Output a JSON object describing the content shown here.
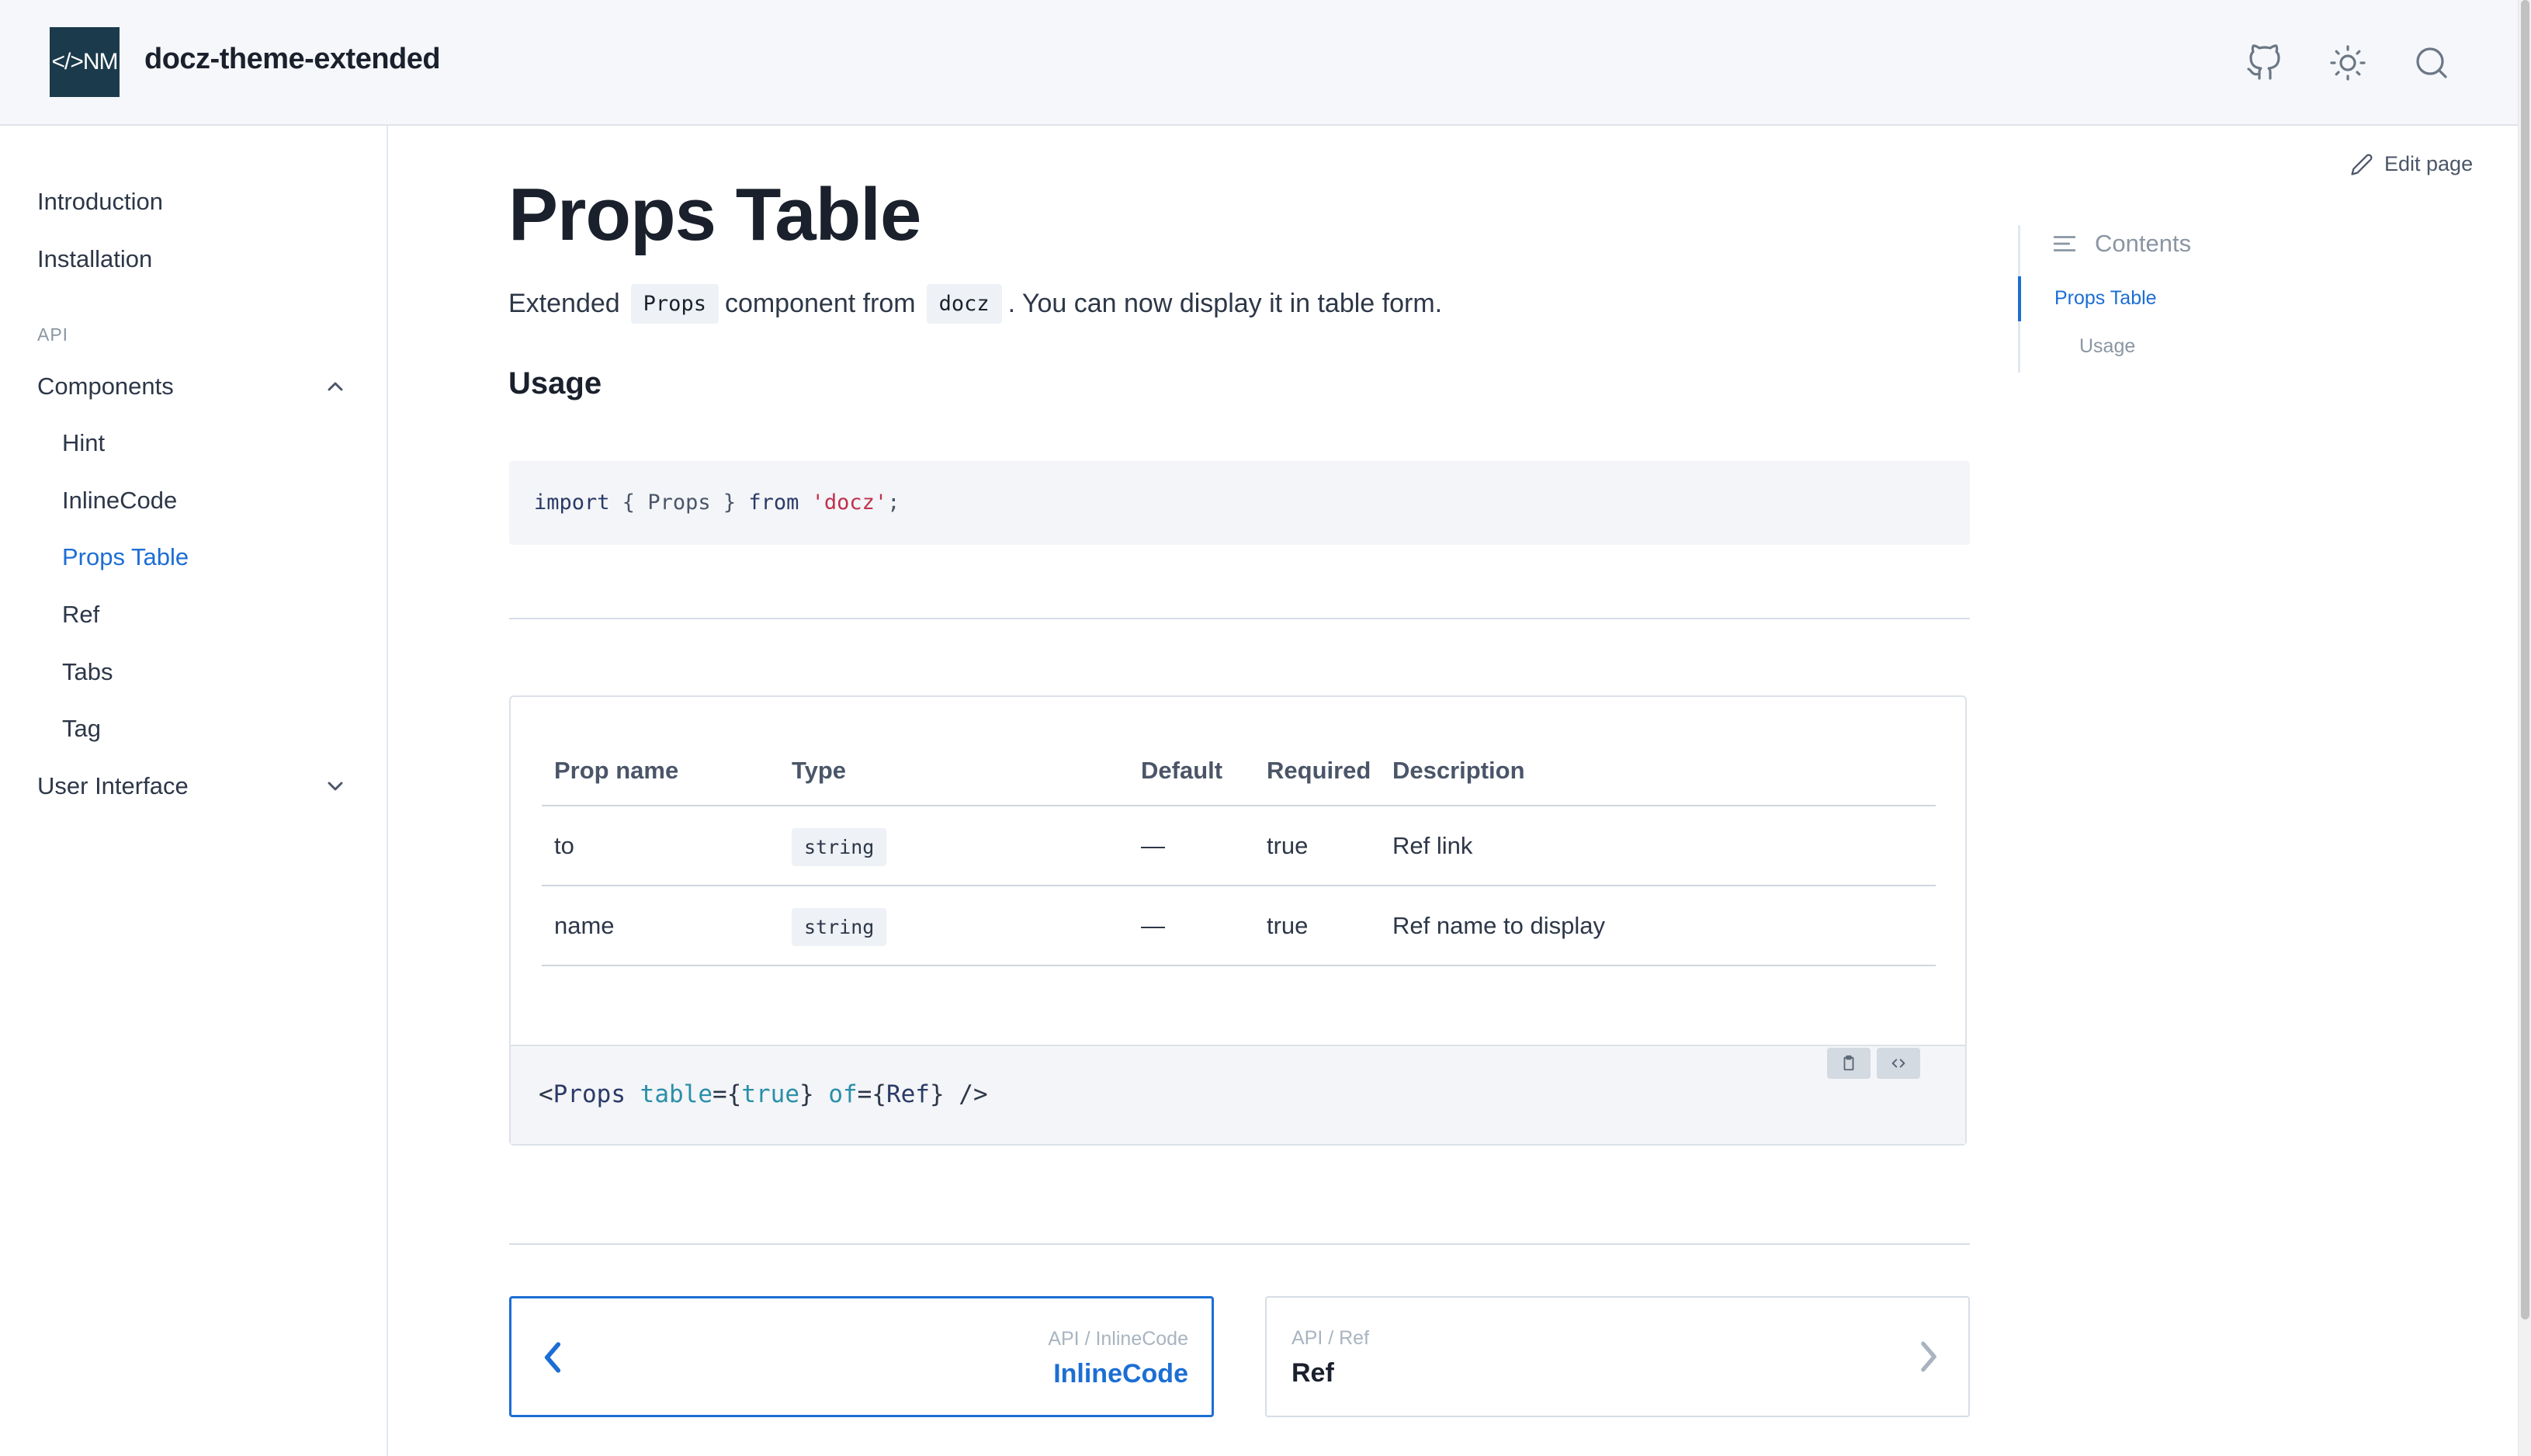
{
  "header": {
    "logo_text": "</>NM",
    "site_title": "docz-theme-extended",
    "icons": [
      "github-icon",
      "sun-icon",
      "search-icon"
    ]
  },
  "sidebar": {
    "items": [
      {
        "label": "Introduction"
      },
      {
        "label": "Installation"
      }
    ],
    "section_label": "API",
    "groups": [
      {
        "label": "Components",
        "expanded": true,
        "children": [
          "Hint",
          "InlineCode",
          "Props Table",
          "Ref",
          "Tabs",
          "Tag"
        ],
        "active_child": "Props Table"
      },
      {
        "label": "User Interface",
        "expanded": false
      }
    ]
  },
  "main": {
    "edit_page": "Edit page",
    "title": "Props Table",
    "intro": {
      "before": "Extended",
      "code1": "Props",
      "middle": "component from",
      "code2": "docz",
      "after": ". You can now display it in table form."
    },
    "usage_heading": "Usage",
    "code_block": {
      "import": "import",
      "braces": " { Props } ",
      "from": "from",
      "module": "'docz'",
      "semi": ";"
    },
    "props_table": {
      "headers": [
        "Prop name",
        "Type",
        "Default",
        "Required",
        "Description"
      ],
      "rows": [
        {
          "name": "to",
          "type": "string",
          "default": "—",
          "required": "true",
          "description": "Ref link"
        },
        {
          "name": "name",
          "type": "string",
          "default": "—",
          "required": "true",
          "description": "Ref name to display"
        }
      ]
    },
    "live_code": {
      "open": "<",
      "tag": "Props",
      "attr1": "table",
      "eq1": "={",
      "val1": "true",
      "close1": "} ",
      "attr2": "of",
      "eq2": "={",
      "val2": "Ref",
      "close2": "} />"
    },
    "pager": {
      "prev": {
        "path": "API / InlineCode",
        "title": "InlineCode"
      },
      "next": {
        "path": "API / Ref",
        "title": "Ref"
      }
    }
  },
  "toc": {
    "heading": "Contents",
    "items": [
      {
        "label": "Props Table",
        "active": true
      },
      {
        "label": "Usage",
        "active": false
      }
    ]
  },
  "colors": {
    "accent": "#1c6ed4",
    "logo_bg": "#1b3a4b",
    "header_bg": "#f5f7fa"
  }
}
